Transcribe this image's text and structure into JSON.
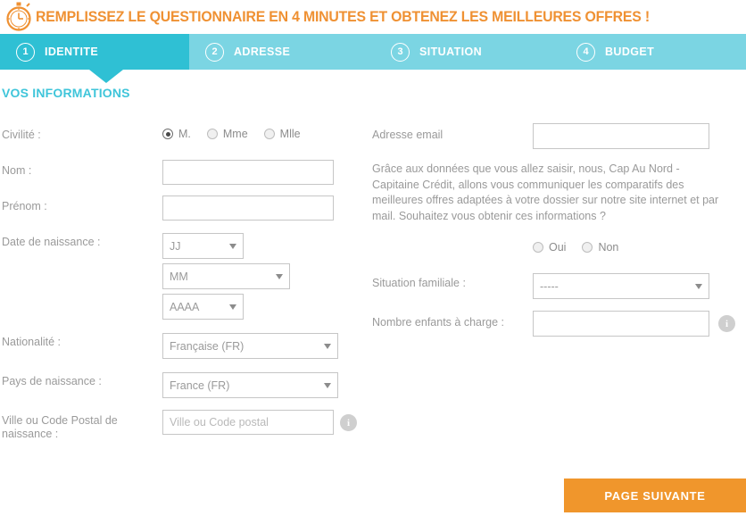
{
  "banner": {
    "icon": "stopwatch-icon",
    "title": "REMPLISSEZ LE QUESTIONNAIRE EN 4 MINUTES ET OBTENEZ LES MEILLEURES OFFRES !",
    "accent_color": "#ef9133"
  },
  "stepnav": {
    "active_color": "#2fc0d4",
    "inactive_color": "#7bd5e3",
    "steps": [
      {
        "number": "1",
        "label": "IDENTITE",
        "active": true
      },
      {
        "number": "2",
        "label": "ADRESSE",
        "active": false
      },
      {
        "number": "3",
        "label": "SITUATION",
        "active": false
      },
      {
        "number": "4",
        "label": "BUDGET",
        "active": false
      }
    ]
  },
  "section": {
    "title": "VOS INFORMATIONS",
    "title_color": "#3fc5da"
  },
  "left_column": {
    "civilite": {
      "label": "Civilité :",
      "options": [
        {
          "label": "M.",
          "checked": true
        },
        {
          "label": "Mme",
          "checked": false
        },
        {
          "label": "Mlle",
          "checked": false
        }
      ]
    },
    "nom": {
      "label": "Nom :",
      "value": "",
      "placeholder": ""
    },
    "prenom": {
      "label": "Prénom :",
      "value": "",
      "placeholder": ""
    },
    "date_naissance": {
      "label": "Date de naissance :",
      "day": "JJ",
      "month": "MM",
      "year": "AAAA"
    },
    "nationalite": {
      "label": "Nationalité :",
      "value": "Française (FR)"
    },
    "pays_naissance": {
      "label": "Pays de naissance :",
      "value": "France (FR)"
    },
    "ville_naissance": {
      "label": "Ville ou Code Postal de naissance :",
      "value": "",
      "placeholder": "Ville ou Code postal",
      "info_icon": "info-icon"
    }
  },
  "right_column": {
    "email": {
      "label": "Adresse email",
      "value": "",
      "placeholder": ""
    },
    "legal_text": "Grâce aux données que vous allez saisir, nous, Cap Au Nord - Capitaine Crédit, allons vous communiquer les comparatifs des meilleures offres adaptées à votre dossier sur notre site internet et par mail. Souhaitez vous obtenir ces informations ?",
    "consent": {
      "options": [
        {
          "label": "Oui",
          "checked": false
        },
        {
          "label": "Non",
          "checked": false
        }
      ]
    },
    "situation_familiale": {
      "label": "Situation familiale :",
      "value": "-----"
    },
    "nombre_enfants": {
      "label": "Nombre enfants à charge :",
      "value": "",
      "placeholder": "",
      "info_icon": "info-icon"
    }
  },
  "footer": {
    "next_button": "PAGE SUIVANTE",
    "next_button_color": "#f0962c"
  }
}
